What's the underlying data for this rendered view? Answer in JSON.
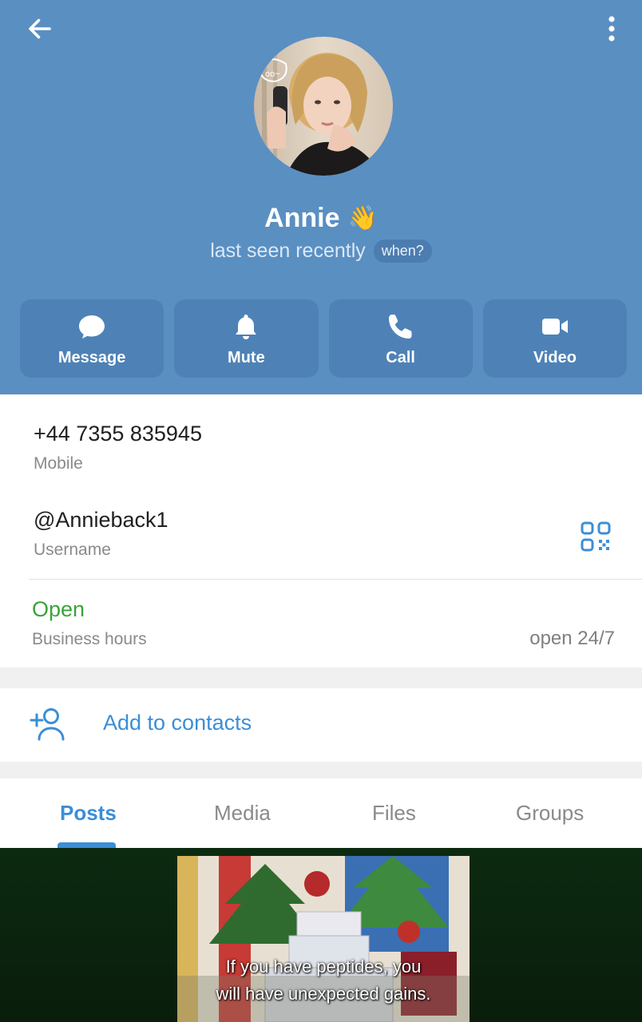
{
  "header": {
    "name": "Annie",
    "name_emoji": "👋",
    "status": "last seen recently",
    "when_label": "when?"
  },
  "actions": [
    {
      "label": "Message",
      "icon": "chat-bubble-icon"
    },
    {
      "label": "Mute",
      "icon": "bell-icon"
    },
    {
      "label": "Call",
      "icon": "phone-icon"
    },
    {
      "label": "Video",
      "icon": "video-camera-icon"
    }
  ],
  "info": {
    "phone": "+44 7355 835945",
    "phone_label": "Mobile",
    "username": "@Annieback1",
    "username_label": "Username",
    "business_status": "Open",
    "business_label": "Business hours",
    "business_hours": "open 24/7"
  },
  "contacts": {
    "add_label": "Add to contacts"
  },
  "tabs": [
    {
      "label": "Posts",
      "active": true
    },
    {
      "label": "Media",
      "active": false
    },
    {
      "label": "Files",
      "active": false
    },
    {
      "label": "Groups",
      "active": false
    }
  ],
  "post": {
    "caption_line1": "If you have peptides, you",
    "caption_line2": "will have unexpected gains."
  },
  "colors": {
    "header_bg": "#5a8fc2",
    "action_bg": "#4e82b6",
    "accent": "#3b8ed6",
    "open_green": "#3aa23a"
  }
}
